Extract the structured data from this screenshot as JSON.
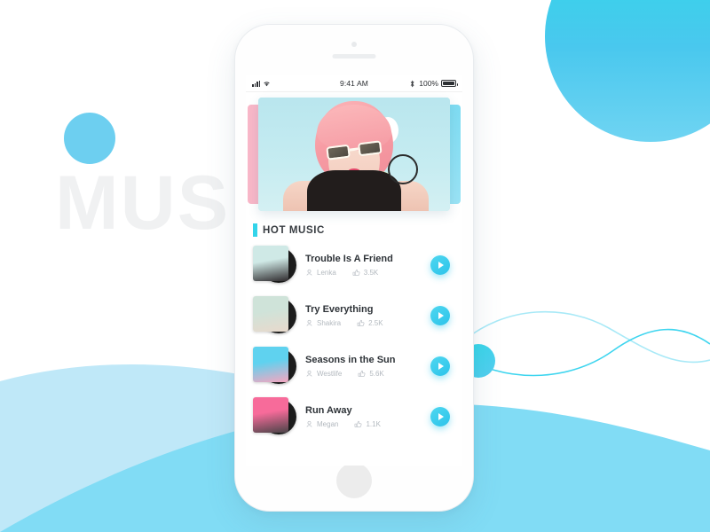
{
  "background": {
    "watermark_text": "MUSIC",
    "accent_color": "#33d4ea",
    "wave_color_light": "#b9e7f7",
    "wave_color_dark": "#7ddcf5",
    "circle_color": "#6dcff0"
  },
  "phone": {
    "home_button_name": "home-button"
  },
  "status_bar": {
    "carrier_signal": "signal-bars-icon",
    "wifi": "wifi-icon",
    "time": "9:41 AM",
    "bluetooth": "bluetooth-icon",
    "battery_percent": "100%"
  },
  "carousel": {
    "slides": [
      {
        "name": "prev-card",
        "color": "#f9b7c8"
      },
      {
        "name": "active-card",
        "alt": "Woman with pink hair and white sunglasses"
      },
      {
        "name": "next-card",
        "color": "#7fdcf2"
      }
    ]
  },
  "section": {
    "title": "HOT MUSIC"
  },
  "songs": [
    {
      "title": "Trouble Is A Friend",
      "artist": "Lenka",
      "likes": "3.5K",
      "art_top": "#cfe9e6",
      "art_bottom": "#2f2b2e"
    },
    {
      "title": "Try Everything",
      "artist": "Shakira",
      "likes": "2.5K",
      "art_top": "#cfe3d9",
      "art_bottom": "#e8d9cc"
    },
    {
      "title": "Seasons in the Sun",
      "artist": "Westlife",
      "likes": "5.6K",
      "art_top": "#5fd2ef",
      "art_bottom": "#f5a6c0"
    },
    {
      "title": "Run Away",
      "artist": "Megan",
      "likes": "1.1K",
      "art_top": "#f76b9a",
      "art_bottom": "#4a4448"
    }
  ],
  "icons": {
    "person": "person-icon",
    "like": "thumbs-up-icon",
    "play": "play-icon"
  }
}
